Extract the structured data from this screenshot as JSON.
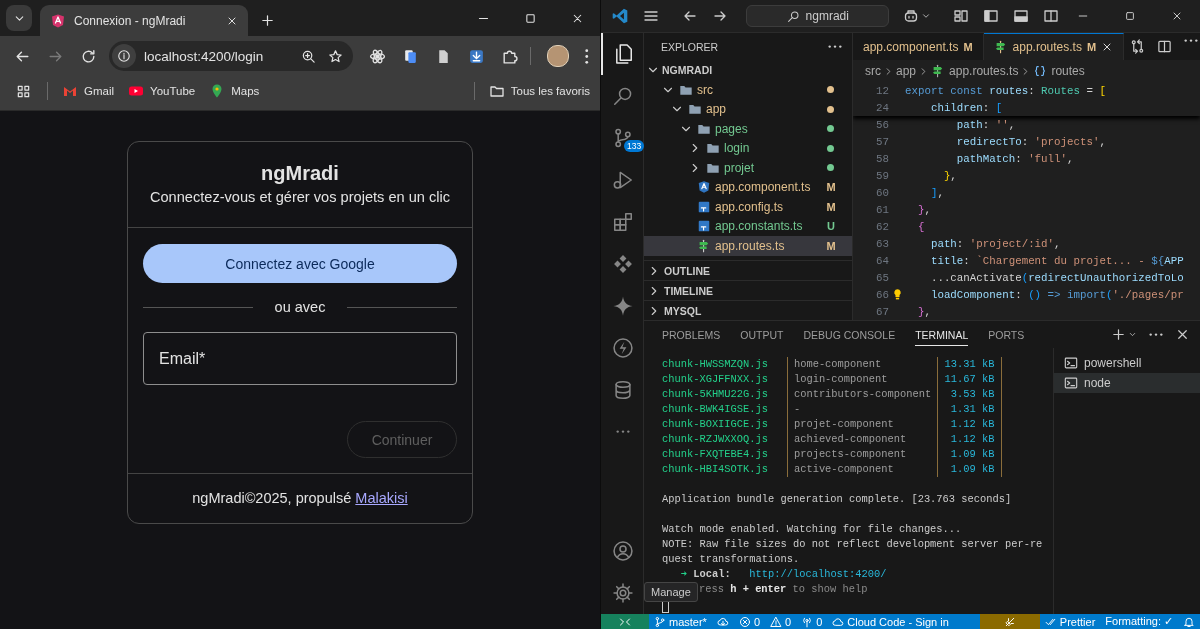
{
  "browser": {
    "tabs": [
      {
        "title": "Connexion - ngMradi",
        "selected": true
      }
    ],
    "navigation": {
      "back_disabled": false,
      "forward_disabled": true
    },
    "address": "localhost:4200/login",
    "bookmarks": [
      {
        "label": "Gmail",
        "kind": "mail"
      },
      {
        "label": "YouTube",
        "kind": "video"
      },
      {
        "label": "Maps",
        "kind": "map"
      }
    ],
    "all_bookmarks": "Tous les favoris"
  },
  "login": {
    "title": "ngMradi",
    "subtitle": "Connectez-vous et gérer vos projets en un clic",
    "google_button": "Connectez avec Google",
    "separator": "ou avec",
    "email": {
      "placeholder": "Email*"
    },
    "continue_button": {
      "label": "Continuer",
      "disabled": true
    },
    "footer": {
      "text": "ngMradi©2025, propulsé",
      "link": "Malakisi"
    }
  },
  "vscode": {
    "search": "ngmradi",
    "activity_bar": [
      {
        "kind": "explorer",
        "selected": true
      },
      {
        "kind": "search",
        "selected": false
      },
      {
        "kind": "source-control",
        "selected": false,
        "badge": "133"
      },
      {
        "kind": "run",
        "selected": false
      },
      {
        "kind": "extensions",
        "selected": false
      },
      {
        "kind": "diamonds",
        "selected": false
      },
      {
        "kind": "sparkle",
        "selected": false
      },
      {
        "kind": "lightning",
        "selected": false
      },
      {
        "kind": "database",
        "selected": false
      },
      {
        "kind": "more",
        "selected": false
      }
    ],
    "activity_bottom": [
      {
        "kind": "account"
      },
      {
        "kind": "manage"
      }
    ],
    "tooltip": "Manage",
    "sidebar": {
      "title": "EXPLORER",
      "root": "NGMRADI",
      "tree": [
        {
          "label": "src",
          "kind": "folder",
          "expanded": true,
          "selected": false,
          "color": "#e2c08d",
          "children": [
            {
              "label": "app",
              "kind": "folder",
              "expanded": true,
              "selected": false,
              "color": "#e2c08d",
              "children": [
                {
                  "label": "pages",
                  "kind": "folder",
                  "expanded": true,
                  "selected": false,
                  "color": "#73c991",
                  "children": [
                    {
                      "label": "login",
                      "kind": "folder",
                      "expanded": false,
                      "selected": false,
                      "color": "#73c991"
                    },
                    {
                      "label": "projet",
                      "kind": "folder",
                      "expanded": false,
                      "selected": false,
                      "color": "#73c991"
                    }
                  ]
                },
                {
                  "label": "app.component.ts",
                  "kind": "component",
                  "selected": false,
                  "color": "#e2c08d",
                  "badge": "M"
                },
                {
                  "label": "app.config.ts",
                  "kind": "ts",
                  "selected": false,
                  "color": "#e2c08d",
                  "badge": "M"
                },
                {
                  "label": "app.constants.ts",
                  "kind": "ts",
                  "selected": false,
                  "color": "#73c991",
                  "badge": "U"
                },
                {
                  "label": "app.routes.ts",
                  "kind": "routes",
                  "selected": true,
                  "color": "#e2c08d",
                  "badge": "M"
                }
              ]
            }
          ]
        }
      ],
      "sections": [
        {
          "label": "OUTLINE",
          "expanded": false
        },
        {
          "label": "TIMELINE",
          "expanded": false
        },
        {
          "label": "MYSQL",
          "expanded": false
        }
      ]
    },
    "editor": {
      "tabs": [
        {
          "label": "app.component.ts",
          "badge": "M",
          "selected": false
        },
        {
          "label": "app.routes.ts",
          "badge": "M",
          "kind": "routes",
          "selected": true
        }
      ],
      "breadcrumbs": [
        {
          "label": "src",
          "kind": "folder"
        },
        {
          "label": "app",
          "kind": "folder"
        },
        {
          "label": "app.routes.ts",
          "kind": "routes"
        },
        {
          "label": "routes",
          "kind": "symbol"
        }
      ],
      "sticky_lines": [
        {
          "number": "12",
          "tokens": [
            {
              "text": "export const ",
              "kind": "kw"
            },
            {
              "text": "routes",
              "kind": "var"
            },
            {
              "text": ": ",
              "kind": "punct"
            },
            {
              "text": "Routes",
              "kind": "type"
            },
            {
              "text": " = ",
              "kind": "punct"
            },
            {
              "text": "[",
              "kind": "b1"
            }
          ]
        },
        {
          "number": "24",
          "tokens": [
            {
              "text": "    children",
              "kind": "prop"
            },
            {
              "text": ": ",
              "kind": "punct"
            },
            {
              "text": "[",
              "kind": "b3"
            }
          ]
        }
      ],
      "lines": [
        {
          "number": "56",
          "tokens": [
            {
              "text": "        path",
              "kind": "prop"
            },
            {
              "text": ": ",
              "kind": "punct"
            },
            {
              "text": "''",
              "kind": "str"
            },
            {
              "text": ",",
              "kind": "punct"
            }
          ]
        },
        {
          "number": "57",
          "tokens": [
            {
              "text": "        redirectTo",
              "kind": "prop"
            },
            {
              "text": ": ",
              "kind": "punct"
            },
            {
              "text": "'projects'",
              "kind": "str"
            },
            {
              "text": ",",
              "kind": "punct"
            }
          ]
        },
        {
          "number": "58",
          "tokens": [
            {
              "text": "        pathMatch",
              "kind": "prop"
            },
            {
              "text": ": ",
              "kind": "punct"
            },
            {
              "text": "'full'",
              "kind": "str"
            },
            {
              "text": ",",
              "kind": "punct"
            }
          ]
        },
        {
          "number": "59",
          "tokens": [
            {
              "text": "      }",
              "kind": "b1"
            },
            {
              "text": ",",
              "kind": "punct"
            }
          ]
        },
        {
          "number": "60",
          "tokens": [
            {
              "text": "    ]",
              "kind": "b3"
            },
            {
              "text": ",",
              "kind": "punct"
            }
          ]
        },
        {
          "number": "61",
          "tokens": [
            {
              "text": "  }",
              "kind": "b2"
            },
            {
              "text": ",",
              "kind": "punct"
            }
          ]
        },
        {
          "number": "62",
          "tokens": [
            {
              "text": "  {",
              "kind": "b2"
            }
          ]
        },
        {
          "number": "63",
          "tokens": [
            {
              "text": "    path",
              "kind": "prop"
            },
            {
              "text": ": ",
              "kind": "punct"
            },
            {
              "text": "'project/:id'",
              "kind": "str"
            },
            {
              "text": ",",
              "kind": "punct"
            }
          ]
        },
        {
          "number": "64",
          "tokens": [
            {
              "text": "    title",
              "kind": "prop"
            },
            {
              "text": ": ",
              "kind": "punct"
            },
            {
              "text": "`Chargement du projet... - ",
              "kind": "str"
            },
            {
              "text": "${",
              "kind": "kw"
            },
            {
              "text": "APP",
              "kind": "var"
            }
          ]
        },
        {
          "number": "65",
          "tokens": [
            {
              "text": "    ...canActivate",
              "kind": "punct"
            },
            {
              "text": "(",
              "kind": "b3"
            },
            {
              "text": "redirectUnauthorizedToLo",
              "kind": "var"
            }
          ]
        },
        {
          "number": "66",
          "lightbulb": true,
          "tokens": [
            {
              "text": "    loadComponent",
              "kind": "prop"
            },
            {
              "text": ": ",
              "kind": "punct"
            },
            {
              "text": "()",
              "kind": "b3"
            },
            {
              "text": " => ",
              "kind": "kw"
            },
            {
              "text": "import",
              "kind": "kw"
            },
            {
              "text": "(",
              "kind": "b3"
            },
            {
              "text": "'./pages/pr",
              "kind": "str"
            }
          ]
        },
        {
          "number": "67",
          "tokens": [
            {
              "text": "  }",
              "kind": "b2"
            },
            {
              "text": ",",
              "kind": "punct"
            }
          ]
        }
      ]
    },
    "panel": {
      "tabs": [
        {
          "label": "PROBLEMS",
          "selected": false
        },
        {
          "label": "OUTPUT",
          "selected": false
        },
        {
          "label": "DEBUG CONSOLE",
          "selected": false
        },
        {
          "label": "TERMINAL",
          "selected": true
        },
        {
          "label": "PORTS",
          "selected": false
        }
      ],
      "terminal": {
        "chunks": [
          {
            "file": "chunk-HWSSMZQN.js",
            "name": "home-component",
            "size": "13.31 kB"
          },
          {
            "file": "chunk-XGJFFNXX.js",
            "name": "login-component",
            "size": "11.67 kB"
          },
          {
            "file": "chunk-5KHMU22G.js",
            "name": "contributors-component",
            "size": "3.53 kB"
          },
          {
            "file": "chunk-BWK4IGSE.js",
            "name": "-",
            "size": "1.31 kB"
          },
          {
            "file": "chunk-BOXIIGCE.js",
            "name": "projet-component",
            "size": "1.12 kB"
          },
          {
            "file": "chunk-RZJWXXOQ.js",
            "name": "achieved-component",
            "size": "1.12 kB"
          },
          {
            "file": "chunk-FXQTEBE4.js",
            "name": "projects-component",
            "size": "1.09 kB"
          },
          {
            "file": "chunk-HBI4SOTK.js",
            "name": "active-component",
            "size": "1.09 kB"
          }
        ],
        "lines": [
          {
            "kind": "blank"
          },
          {
            "kind": "text",
            "text": "Application bundle generation complete. [23.763 seconds]"
          },
          {
            "kind": "blank"
          },
          {
            "kind": "text",
            "text": "Watch mode enabled. Watching for file changes..."
          },
          {
            "kind": "text",
            "text": "NOTE: Raw file sizes do not reflect development server per-re"
          },
          {
            "kind": "text",
            "text": "quest transformations."
          },
          {
            "kind": "url",
            "arrow": "➜",
            "label": "Local:",
            "url": "http://localhost:4200/"
          },
          {
            "kind": "hint",
            "text": "ress **h + enter** to show help"
          },
          {
            "kind": "cursor"
          }
        ]
      },
      "shells": [
        {
          "label": "powershell",
          "selected": false
        },
        {
          "label": "node",
          "selected": true
        }
      ]
    },
    "status_bar": {
      "left": [
        {
          "kind": "remote"
        },
        {
          "kind": "branch",
          "text": "master*"
        },
        {
          "kind": "sync"
        },
        {
          "kind": "errors",
          "text": "0"
        },
        {
          "kind": "warnings",
          "text": "0"
        },
        {
          "kind": "ports",
          "text": "0"
        },
        {
          "kind": "cloud",
          "text": "Cloud Code - Sign in"
        }
      ],
      "right": [
        {
          "kind": "plugin"
        },
        {
          "kind": "prettier",
          "text": "Prettier"
        },
        {
          "kind": "formatting",
          "text": "Formatting: ✓"
        },
        {
          "kind": "bell"
        }
      ]
    }
  }
}
